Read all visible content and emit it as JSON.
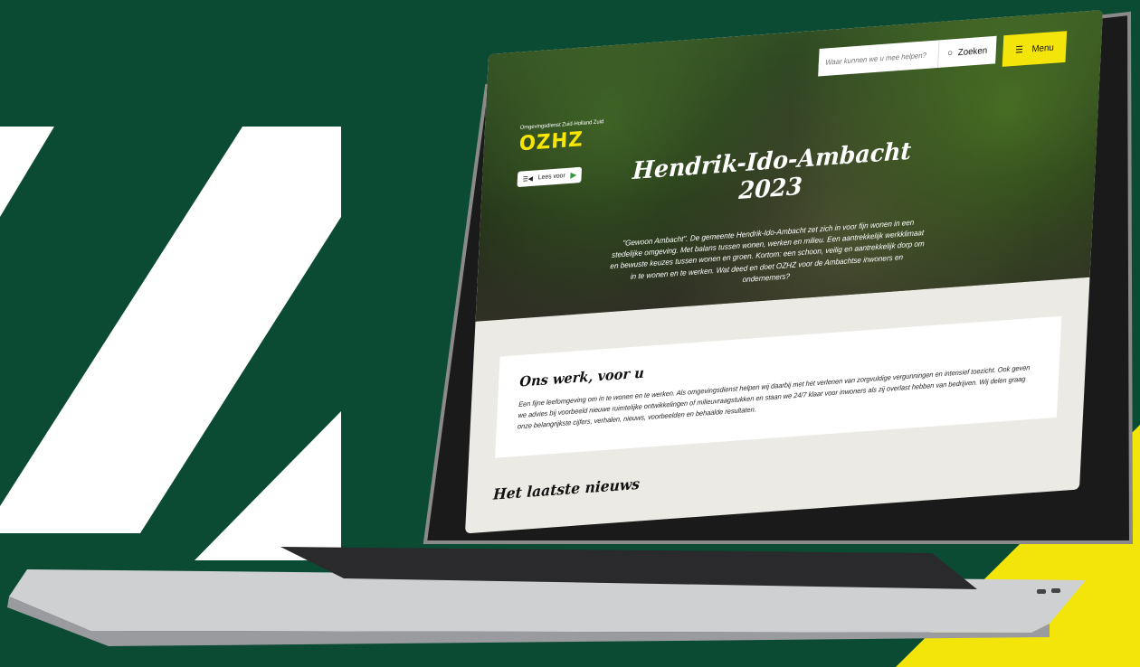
{
  "site": {
    "logo_subtitle": "Omgevingsdienst Zuid-Holland Zuid",
    "logo_text": "OZHZ",
    "read_aloud_label": "Lees voor"
  },
  "header": {
    "search_placeholder": "Waar kunnen we u mee helpen?",
    "search_button": "Zoeken",
    "menu_button": "Menu"
  },
  "hero": {
    "title_line1": "Hendrik-Ido-Ambacht",
    "title_line2": "2023",
    "text": "\"Gewoon Ambacht\". De gemeente Hendrik-Ido-Ambacht zet zich in voor fijn wonen in een stedelijke omgeving. Met balans tussen wonen, werken en milieu. Een aantrekkelijk werkklimaat en bewuste keuzes tussen wonen en groen. Kortom: een schoon, veilig en aantrekkelijk dorp om in te wonen en te werken. Wat deed en doet OZHZ voor de Ambachtse inwoners en ondernemers?"
  },
  "intro": {
    "heading": "Ons werk, voor u",
    "text": "Een fijne leefomgeving om in te wonen en te werken. Als omgevingsdienst helpen wij daarbij met het verlenen van zorgvuldige vergunningen en intensief toezicht. Ook geven we advies bij voorbeeld nieuwe ruimtelijke ontwikkelingen of milieuvraagstukken en staan we 24/7 klaar voor inwoners als zij overlast hebben van bedrijven. Wij delen graag onze belangrijkste cijfers, verhalen, nieuws, voorbeelden en behaalde resultaten."
  },
  "news": {
    "heading": "Het laatste nieuws"
  },
  "colors": {
    "brand_green": "#0b4a33",
    "brand_yellow": "#f3e50a"
  }
}
